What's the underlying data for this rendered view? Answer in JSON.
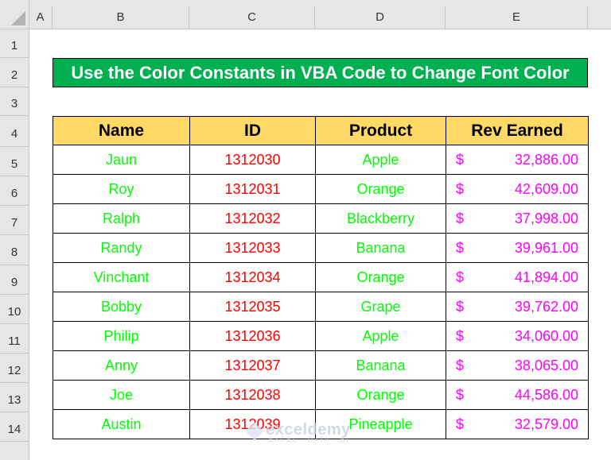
{
  "sheet": {
    "column_headers": [
      "A",
      "B",
      "C",
      "D",
      "E"
    ],
    "row_headers": [
      "1",
      "2",
      "3",
      "4",
      "5",
      "6",
      "7",
      "8",
      "9",
      "10",
      "11",
      "12",
      "13",
      "14"
    ]
  },
  "title": "Use the Color Constants in VBA Code to Change Font Color",
  "table": {
    "headers": [
      "Name",
      "ID",
      "Product",
      "Rev Earned"
    ],
    "currency_symbol": "$",
    "rows": [
      {
        "name": "Jaun",
        "id": "1312030",
        "product": "Apple",
        "rev": "32,886.00"
      },
      {
        "name": "Roy",
        "id": "1312031",
        "product": "Orange",
        "rev": "42,609.00"
      },
      {
        "name": "Ralph",
        "id": "1312032",
        "product": "Blackberry",
        "rev": "37,998.00"
      },
      {
        "name": "Randy",
        "id": "1312033",
        "product": "Banana",
        "rev": "39,961.00"
      },
      {
        "name": "Vinchant",
        "id": "1312034",
        "product": "Orange",
        "rev": "41,894.00"
      },
      {
        "name": "Bobby",
        "id": "1312035",
        "product": "Grape",
        "rev": "39,762.00"
      },
      {
        "name": "Philip",
        "id": "1312036",
        "product": "Apple",
        "rev": "34,060.00"
      },
      {
        "name": "Anny",
        "id": "1312037",
        "product": "Banana",
        "rev": "38,065.00"
      },
      {
        "name": "Joe",
        "id": "1312038",
        "product": "Orange",
        "rev": "44,586.00"
      },
      {
        "name": "Austin",
        "id": "1312039",
        "product": "Pineapple",
        "rev": "32,579.00"
      }
    ]
  },
  "colors": {
    "title_fill": "#00b050",
    "header_fill": "#ffd966",
    "name_font": "#00ff00",
    "id_font": "#ff0000",
    "product_font": "#00ff00",
    "rev_font": "#ff00ff"
  },
  "watermark": {
    "main": "exceldemy",
    "sub": "EXCEL · DATA · BI"
  }
}
